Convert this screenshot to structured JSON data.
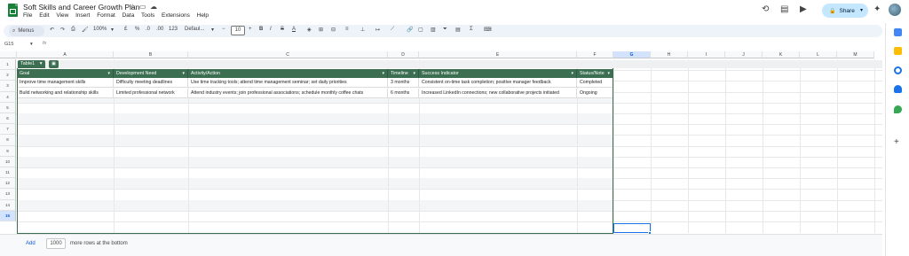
{
  "app": {
    "title": "Soft Skills and Career Growth Plan",
    "menu": [
      "File",
      "Edit",
      "View",
      "Insert",
      "Format",
      "Data",
      "Tools",
      "Extensions",
      "Help"
    ],
    "share_label": "Share"
  },
  "toolbar": {
    "menus_label": "Menus",
    "zoom": "100%",
    "currency": "£",
    "percent": "%",
    "dec_decrease": ".0",
    "dec_increase": ".00",
    "number_format": "123",
    "font": "Defaul...",
    "font_size": "10"
  },
  "formula_bar": {
    "cell_ref": "G15",
    "fx": "fx",
    "value": ""
  },
  "grid": {
    "columns": [
      "A",
      "B",
      "C",
      "D",
      "E",
      "F",
      "G",
      "H",
      "I",
      "J",
      "K",
      "L",
      "M"
    ],
    "selected_column": "G",
    "rows": [
      "1",
      "2",
      "3",
      "4",
      "5",
      "6",
      "7",
      "8",
      "9",
      "10",
      "11",
      "12",
      "13",
      "14",
      "15"
    ],
    "selected_row": "15"
  },
  "table": {
    "name": "Table1",
    "headers": [
      "Goal",
      "Development Need",
      "Activity/Action",
      "Timeline",
      "Success Indicator",
      "Status/Note"
    ],
    "rows": [
      [
        "Improve time management skills",
        "Difficulty meeting deadlines",
        "Use time tracking tools; attend time management seminar; set daily priorities",
        "3 months",
        "Consistent on-time task completion; positive manager feedback",
        "Completed"
      ],
      [
        "Build networking and relationship skills",
        "Limited professional network",
        "Attend industry events; join professional associations; schedule monthly coffee chats",
        "6 months",
        "Increased LinkedIn connections; new collaborative projects initiated",
        "Ongoing"
      ]
    ]
  },
  "footer": {
    "add_label": "Add",
    "rows_value": "1000",
    "rows_suffix": "more rows at the bottom"
  },
  "colors": {
    "table_header": "#3c6e52",
    "accent": "#1a73e8",
    "share_bg": "#c2e7ff"
  }
}
